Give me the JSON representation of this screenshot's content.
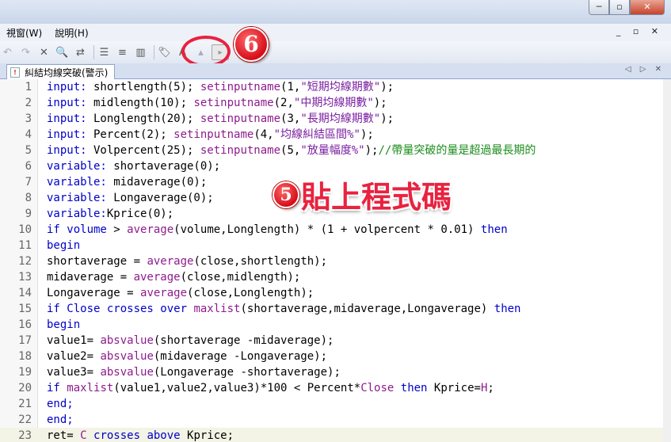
{
  "window": {
    "controls": [
      "─",
      "▫",
      "✕"
    ]
  },
  "menu": {
    "items": [
      "視窗(W)",
      "說明(H)"
    ],
    "mdi_controls": "_ ▫ ✕"
  },
  "toolbar": {
    "icons": [
      "undo-icon",
      "redo-icon",
      "delete-icon",
      "find-icon",
      "replace-icon",
      "align-left-icon",
      "align-center-icon",
      "columns-icon",
      "tag-icon",
      "font-icon",
      "text-size-icon",
      "insert-function-icon"
    ]
  },
  "annotations": {
    "badge6": "6",
    "badge5": "5",
    "note5": "貼上程式碼"
  },
  "tab": {
    "title": "糾結均線突破(警示)",
    "nav": "◁ ▷ ✕"
  },
  "editor": {
    "lines": [
      {
        "n": "1"
      },
      {
        "n": "2"
      },
      {
        "n": "3"
      },
      {
        "n": "4"
      },
      {
        "n": "5"
      },
      {
        "n": "6"
      },
      {
        "n": "7"
      },
      {
        "n": "8"
      },
      {
        "n": "9"
      },
      {
        "n": "10"
      },
      {
        "n": "11"
      },
      {
        "n": "12"
      },
      {
        "n": "13"
      },
      {
        "n": "14"
      },
      {
        "n": "15"
      },
      {
        "n": "16"
      },
      {
        "n": "17"
      },
      {
        "n": "18"
      },
      {
        "n": "19"
      },
      {
        "n": "20"
      },
      {
        "n": "21"
      },
      {
        "n": "22"
      },
      {
        "n": "23"
      }
    ],
    "code": {
      "l1_kw": "input:",
      "l1_a": " shortlength(5); ",
      "l1_fn": "setinputname",
      "l1_b": "(1,",
      "l1_s": "\"短期均線期數\"",
      "l1_c": ");",
      "l2_kw": "input:",
      "l2_a": " midlength(10); ",
      "l2_fn": "setinputname",
      "l2_b": "(2,",
      "l2_s": "\"中期均線期數\"",
      "l2_c": ");",
      "l3_kw": "input:",
      "l3_a": " Longlength(20); ",
      "l3_fn": "setinputname",
      "l3_b": "(3,",
      "l3_s": "\"長期均線期數\"",
      "l3_c": ");",
      "l4_kw": "input:",
      "l4_a": " Percent(2); ",
      "l4_fn": "setinputname",
      "l4_b": "(4,",
      "l4_s": "\"均線糾結區間%\"",
      "l4_c": ");",
      "l5_kw": "input:",
      "l5_a": " Volpercent(25); ",
      "l5_fn": "setinputname",
      "l5_b": "(5,",
      "l5_s": "\"放量幅度%\"",
      "l5_c": ");",
      "l5_cm": "//帶量突破的量是超過最長期的",
      "l6_kw": "variable:",
      "l6_a": " shortaverage(0);",
      "l7_kw": "variable:",
      "l7_a": " midaverage(0);",
      "l8_kw": "variable:",
      "l8_a": " Longaverage(0);",
      "l9_kw": "variable:",
      "l9_a": "Kprice(0);",
      "l10_kw": "if volume",
      "l10_a": " > ",
      "l10_fn": "average",
      "l10_b": "(volume,Longlength) * (1 + volpercent * 0.01) ",
      "l10_kw2": "then",
      "l11_kw": "begin",
      "l12_a": "shortaverage = ",
      "l12_fn": "average",
      "l12_b": "(close,shortlength);",
      "l13_a": "midaverage = ",
      "l13_fn": "average",
      "l13_b": "(close,midlength);",
      "l14_a": "Longaverage = ",
      "l14_fn": "average",
      "l14_b": "(close,Longlength);",
      "l15_kw": "if Close crosses over",
      "l15_a": " ",
      "l15_fn": "maxlist",
      "l15_b": "(shortaverage,midaverage,Longaverage) ",
      "l15_kw2": "then",
      "l16_kw": "begin",
      "l17_a": "value1= ",
      "l17_fn": "absvalue",
      "l17_b": "(shortaverage -midaverage);",
      "l18_a": "value2= ",
      "l18_fn": "absvalue",
      "l18_b": "(midaverage -Longaverage);",
      "l19_a": "value3= ",
      "l19_fn": "absvalue",
      "l19_b": "(Longaverage -shortaverage);",
      "l20_kw": "if",
      "l20_a": " ",
      "l20_fn": "maxlist",
      "l20_b": "(value1,value2,value3)*100 < Percent*",
      "l20_fn2": "Close",
      "l20_kw2": " then",
      "l20_c": " Kprice=",
      "l20_fn3": "H",
      "l20_d": ";",
      "l21_kw": "end;",
      "l22_kw": "end;",
      "l23_a": "ret= ",
      "l23_fn": "C",
      "l23_kw": " crosses above",
      "l23_b": " Kprice;"
    }
  }
}
